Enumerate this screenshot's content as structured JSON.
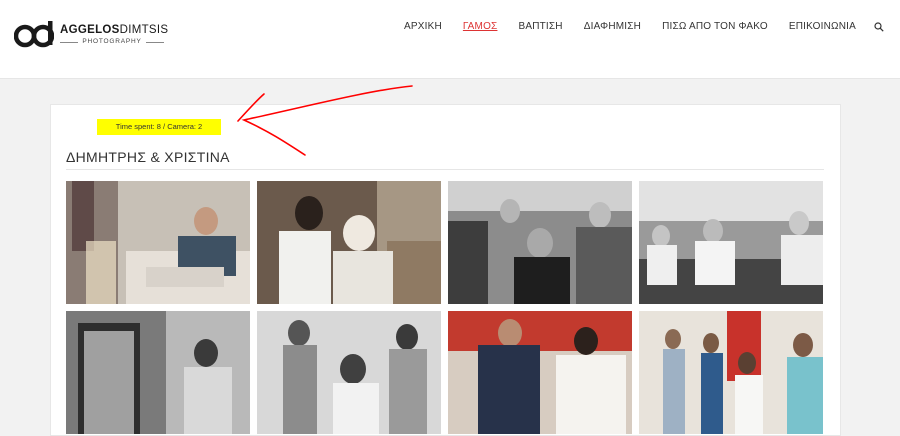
{
  "brand": {
    "name_bold": "AGGELOS",
    "name_light": "DIMTSIS",
    "tagline": "PHOTOGRAPHY"
  },
  "nav": {
    "items": [
      {
        "label": "ΑΡΧΙΚΗ"
      },
      {
        "label": "ΓΑΜΟΣ"
      },
      {
        "label": "ΒΑΠΤΙΣΗ"
      },
      {
        "label": "ΔΙΑΦΗΜΙΣΗ"
      },
      {
        "label": "ΠΙΣΩ ΑΠΟ ΤΟΝ ΦΑΚΟ"
      },
      {
        "label": "ΕΠΙΚΟΙΝΩΝΙΑ"
      }
    ],
    "active_index": 1,
    "search_icon": "search-icon"
  },
  "annotation": {
    "text": "Time spent: 8   /   Camera: 2",
    "highlight_color": "#ffff00",
    "arrow_color": "#ff0000"
  },
  "page": {
    "title": "ΔΗΜΗΤΡΗΣ & ΧΡΙΣΤΙΝΑ"
  },
  "gallery": {
    "photos": [
      {
        "subject": "groom-dressing"
      },
      {
        "subject": "groom-shaving"
      },
      {
        "subject": "groom-friends-party"
      },
      {
        "subject": "friends-dancing"
      },
      {
        "subject": "bride-mirror"
      },
      {
        "subject": "bridesmaids-laughing"
      },
      {
        "subject": "bride-shoes"
      },
      {
        "subject": "bride-with-family"
      }
    ]
  },
  "colors": {
    "accent": "#d33333",
    "header_bg": "#ffffff",
    "page_bg": "#f2f2f2"
  }
}
